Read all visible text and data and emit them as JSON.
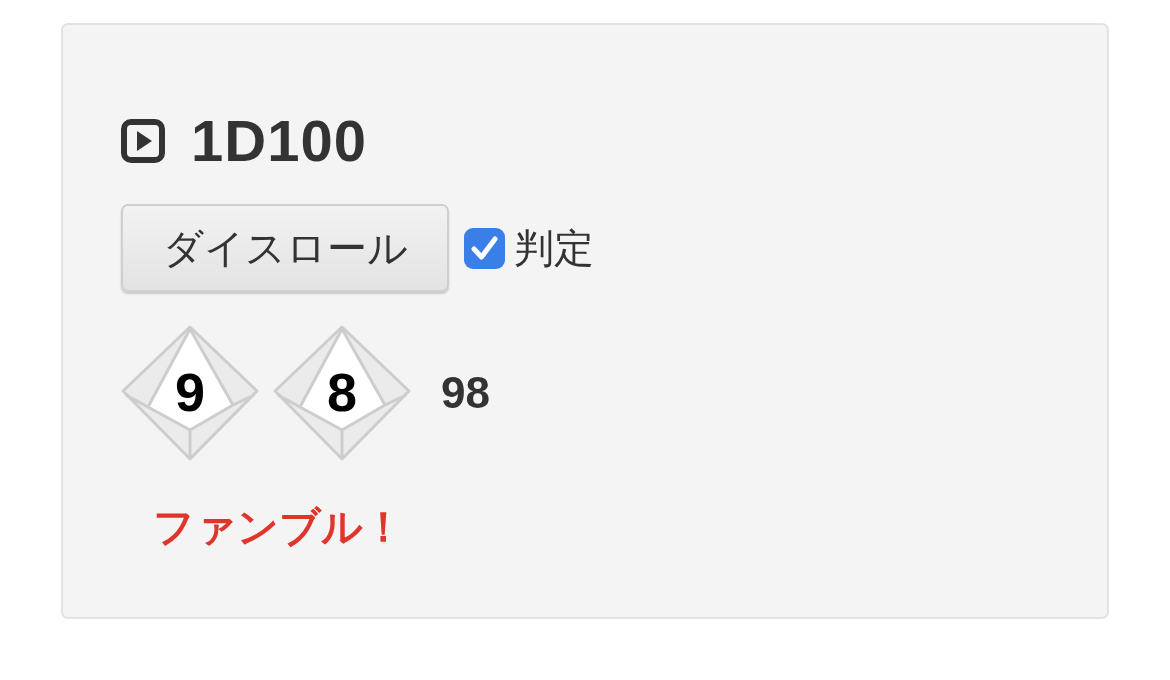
{
  "panel": {
    "title": "1D100",
    "roll_button": {
      "label": "ダイスロール"
    },
    "judge_checkbox": {
      "label": "判定",
      "checked": true
    },
    "dice": [
      {
        "value": "9"
      },
      {
        "value": "8"
      }
    ],
    "total": "98",
    "result": {
      "kind": "fumble",
      "text": "ファンブル！"
    }
  }
}
